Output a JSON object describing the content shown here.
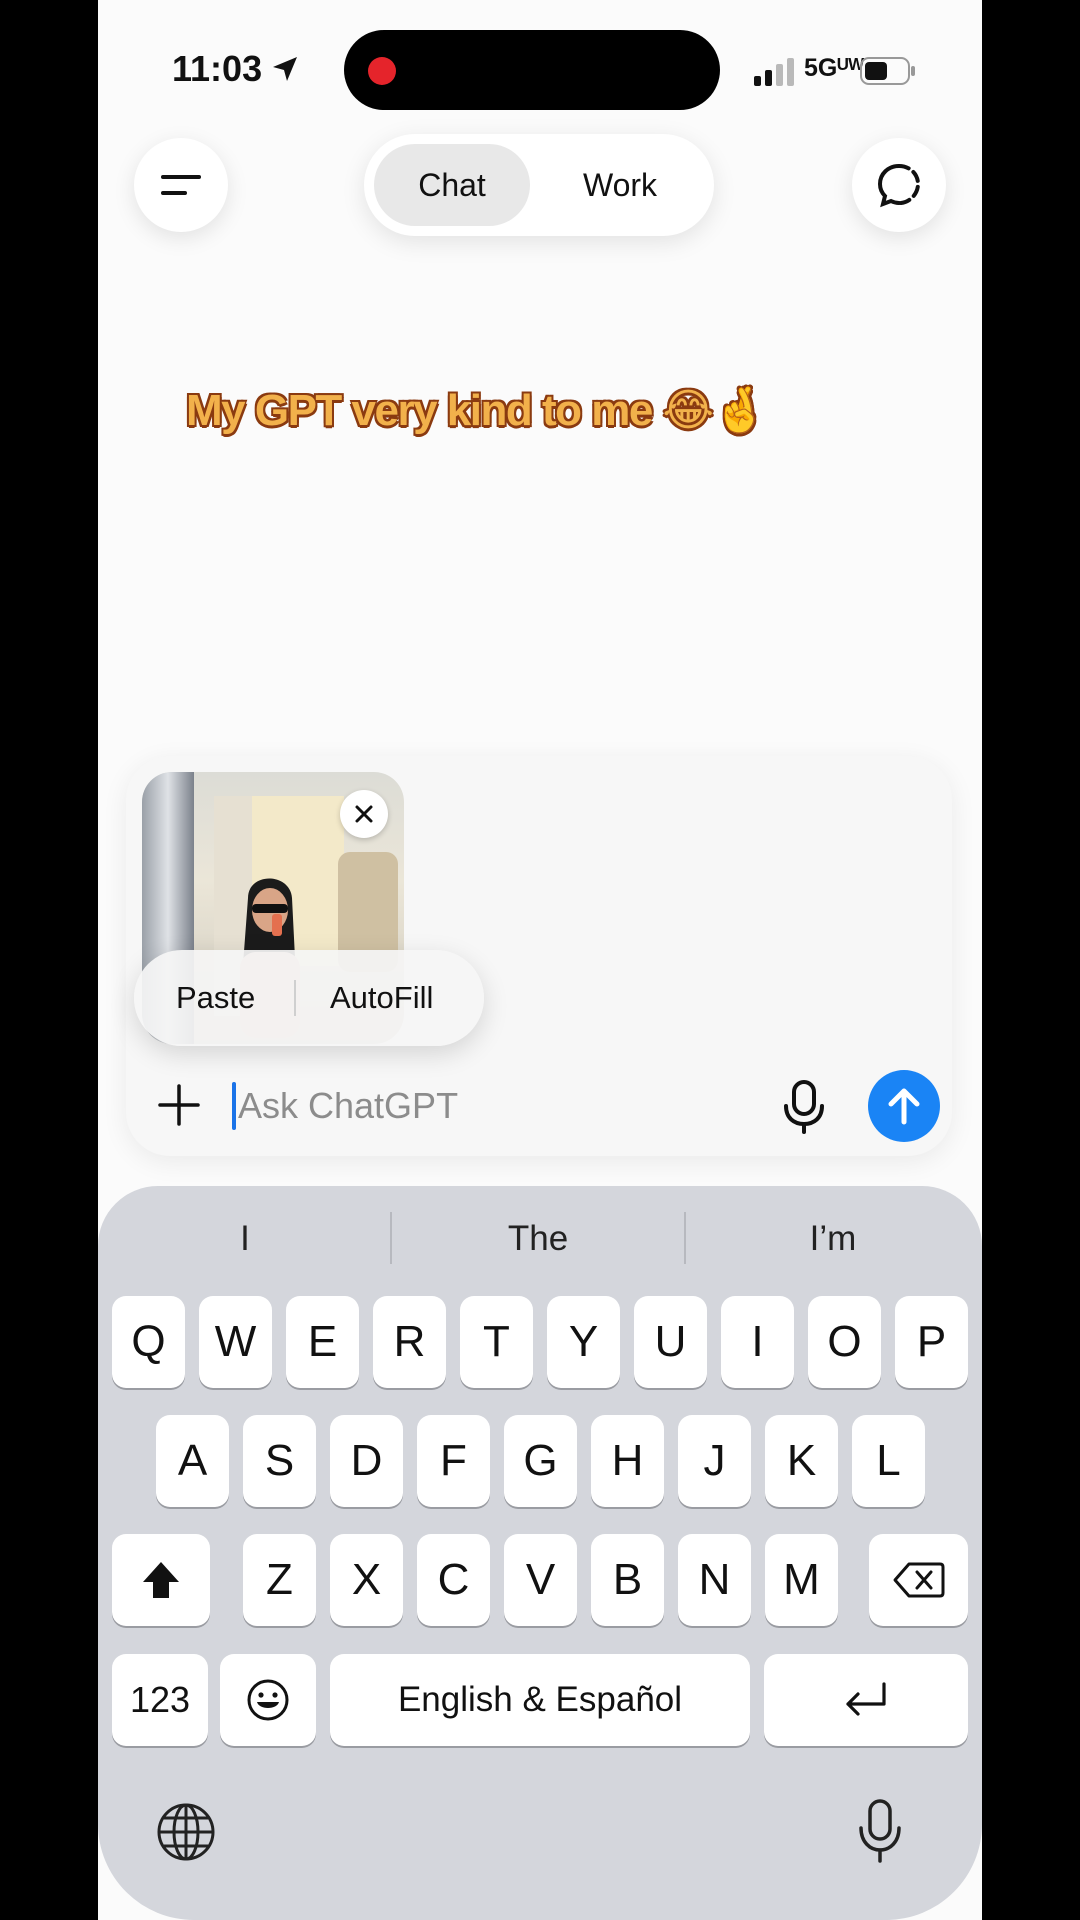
{
  "status_bar": {
    "time": "11:03",
    "network": "5Gᵁᵂ",
    "icons": [
      "location-arrow-icon",
      "recording-dot-icon",
      "cellular-signal-icon",
      "battery-icon"
    ]
  },
  "header": {
    "menu_icon": "hamburger-icon",
    "tabs": [
      {
        "label": "Chat",
        "selected": true
      },
      {
        "label": "Work",
        "selected": false
      }
    ],
    "new_chat_icon": "new-chat-icon"
  },
  "caption": {
    "text": "My GPT very kind to me 😂🤞"
  },
  "composer": {
    "attachment": {
      "type": "photo",
      "remove_icon": "close-icon"
    },
    "edit_menu": {
      "paste": "Paste",
      "autofill": "AutoFill"
    },
    "input": {
      "placeholder": "Ask ChatGPT",
      "value": ""
    },
    "icons": [
      "plus-icon",
      "microphone-icon",
      "send-arrow-icon"
    ],
    "send_color": "#1a84f5"
  },
  "keyboard": {
    "suggestions": [
      "I",
      "The",
      "I’m"
    ],
    "row1": [
      "Q",
      "W",
      "E",
      "R",
      "T",
      "Y",
      "U",
      "I",
      "O",
      "P"
    ],
    "row2": [
      "A",
      "S",
      "D",
      "F",
      "G",
      "H",
      "J",
      "K",
      "L"
    ],
    "row3": [
      "Z",
      "X",
      "C",
      "V",
      "B",
      "N",
      "M"
    ],
    "numbers_key": "123",
    "space_label": "English & Español",
    "icons": [
      "shift-icon",
      "backspace-icon",
      "emoji-icon",
      "return-icon",
      "globe-icon",
      "dictation-icon"
    ]
  }
}
